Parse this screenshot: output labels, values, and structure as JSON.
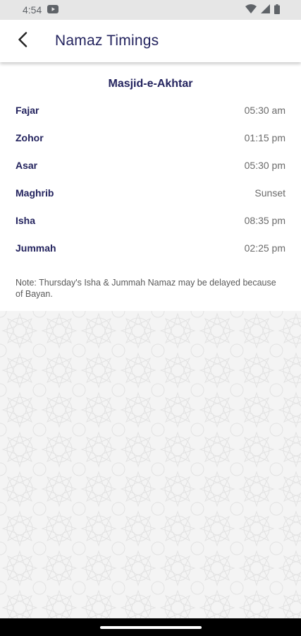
{
  "status_bar": {
    "time": "4:54"
  },
  "header": {
    "title": "Namaz Timings"
  },
  "masjid": {
    "name": "Masjid-e-Akhtar"
  },
  "timings": [
    {
      "name": "Fajar",
      "time": "05:30 am"
    },
    {
      "name": "Zohor",
      "time": "01:15 pm"
    },
    {
      "name": "Asar",
      "time": "05:30 pm"
    },
    {
      "name": "Maghrib",
      "time": "Sunset"
    },
    {
      "name": "Isha",
      "time": "08:35 pm"
    },
    {
      "name": "Jummah",
      "time": "02:25 pm"
    }
  ],
  "note": "Note: Thursday's Isha & Jummah Namaz may be delayed because of Bayan.",
  "colors": {
    "primary_text": "#23235e",
    "time_text": "#6a6a6a",
    "status_bar_bg": "#e6e6e6",
    "pattern_bg": "#f4f4f4",
    "nav_bar_bg": "#000000"
  },
  "icons": {
    "back": "arrow-back-icon",
    "youtube": "youtube-notification-icon",
    "wifi": "wifi-icon",
    "signal": "cell-signal-icon",
    "battery": "battery-icon"
  }
}
